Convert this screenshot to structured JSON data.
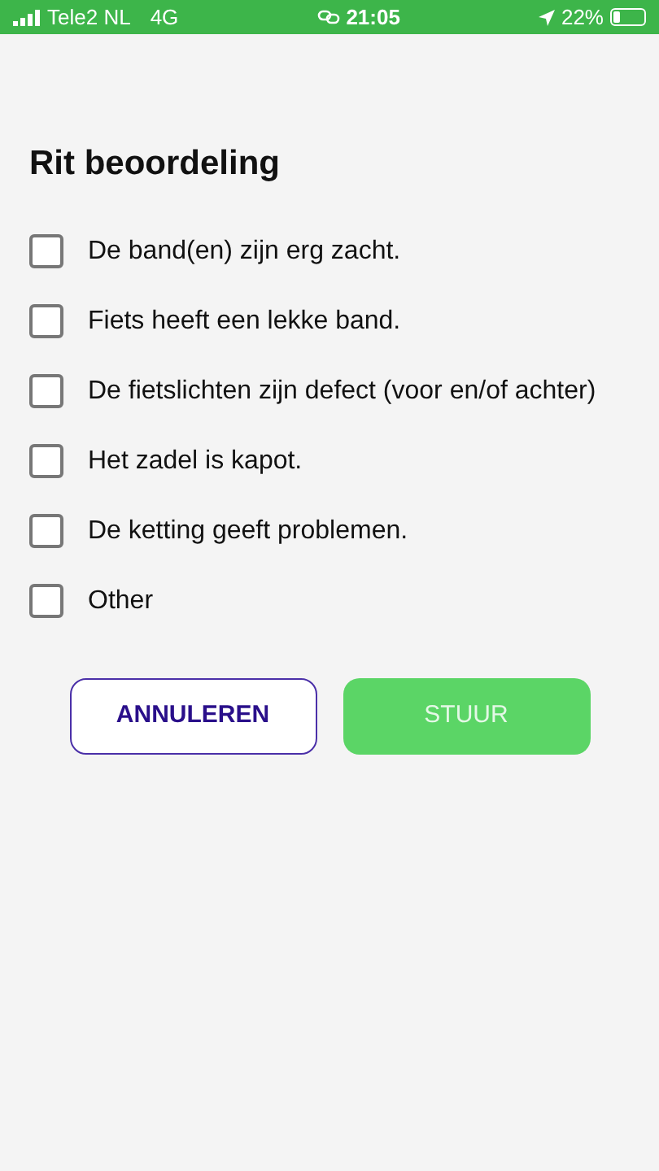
{
  "status_bar": {
    "carrier": "Tele2 NL",
    "network": "4G",
    "time": "21:05",
    "battery": "22%"
  },
  "title": "Rit beoordeling",
  "options": [
    {
      "label": "De band(en) zijn erg zacht.",
      "checked": false
    },
    {
      "label": "Fiets heeft een lekke band.",
      "checked": false
    },
    {
      "label": "De fietslichten zijn defect (voor en/of achter)",
      "checked": false
    },
    {
      "label": "Het zadel is kapot.",
      "checked": false
    },
    {
      "label": "De ketting geeft problemen.",
      "checked": false
    },
    {
      "label": "Other",
      "checked": false
    }
  ],
  "buttons": [
    {
      "label": "ANNULEREN",
      "kind": "outline",
      "disabled": false
    },
    {
      "label": "STUUR",
      "kind": "primary",
      "disabled": true
    }
  ]
}
